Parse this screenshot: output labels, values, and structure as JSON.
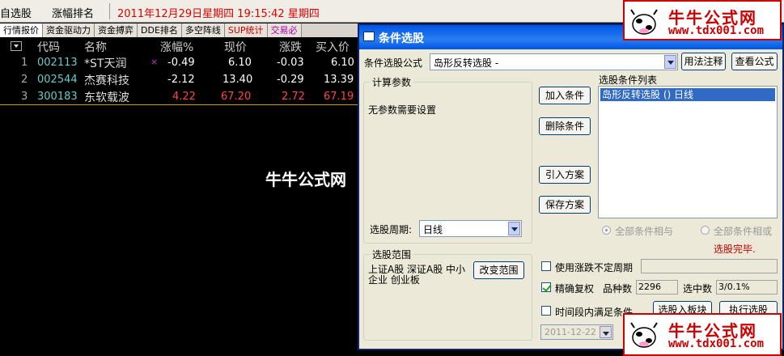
{
  "topbar": {
    "left_label": "自选股",
    "rank_label": "涨幅排名",
    "datetime": "2011年12月29日星期四  19:15:42 星期四"
  },
  "tabs": [
    "行情报价",
    "资金驱动力",
    "资金搏弈",
    "DDE排名",
    "多空阵线",
    "SUP统计",
    "交易必"
  ],
  "table": {
    "headers": {
      "code": "代码",
      "name": "名称",
      "change_pct": "涨幅%",
      "price": "现价",
      "change": "涨跌",
      "bid": "买入价"
    },
    "rows": [
      {
        "num": "1",
        "code": "002113",
        "name": "*ST天润",
        "mark": "×",
        "change_pct": "-0.49",
        "price": "6.10",
        "change": "-0.03",
        "bid": "6.10"
      },
      {
        "num": "2",
        "code": "002544",
        "name": "杰赛科技",
        "mark": "",
        "change_pct": "-2.12",
        "price": "13.40",
        "change": "-0.29",
        "bid": "13.39"
      },
      {
        "num": "3",
        "code": "300183",
        "name": "东软载波",
        "mark": "",
        "change_pct": "4.22",
        "price": "67.20",
        "change": "2.72",
        "bid": "67.19"
      }
    ]
  },
  "dialog": {
    "title": "条件选股",
    "formula_label": "条件选股公式",
    "formula_value": "岛形反转选股 -",
    "usage_button": "用法注释",
    "view_formula_button": "查看公式",
    "params_group": "计算参数",
    "params_text": "无参数需要设置",
    "add_button": "加入条件",
    "delete_button": "删除条件",
    "import_button": "引入方案",
    "save_button": "保存方案",
    "list_label": "选股条件列表",
    "list_items": [
      "岛形反转选股 () 日线"
    ],
    "period_label": "选股周期:",
    "period_value": "日线",
    "radio_and": "全部条件相与",
    "radio_or": "全部条件相或",
    "status": "选股完毕.",
    "range_group": "选股范围",
    "range_text": "上证A股 深证A股 中小企业 创业板",
    "change_range_button": "改变范围",
    "use_period_label": "使用涨跌不定周期",
    "exact_rights_label": "精确复权",
    "count_label": "品种数",
    "count_value": "2296",
    "selected_label": "选中数",
    "selected_value": "3/0.1%",
    "time_label": "时间段内满足条件",
    "date_value": "2011-12-22",
    "to_block_button": "选股入板块",
    "run_button": "执行选股"
  },
  "watermark": {
    "name": "牛牛公式网",
    "url": "www.tdx001.com"
  },
  "colors": {
    "title_blue": "#0054e3",
    "status_red": "#c00000",
    "up_red": "#ff4444"
  }
}
